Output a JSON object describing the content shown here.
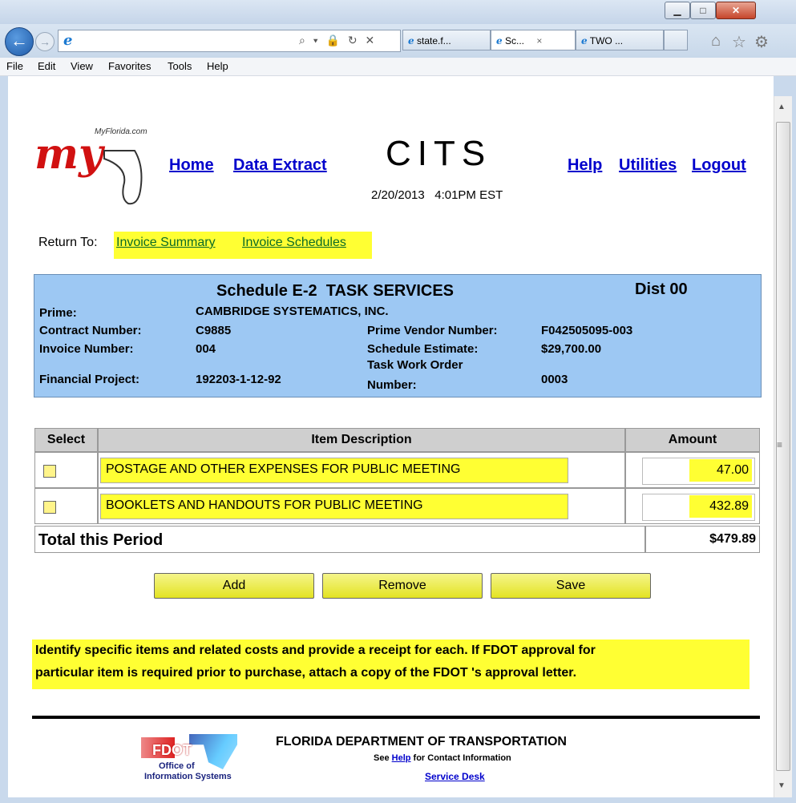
{
  "browser": {
    "tabs": [
      {
        "label": "state.f..."
      },
      {
        "label": "Sc...",
        "close": "×"
      },
      {
        "label": "TWO ..."
      }
    ],
    "address_icons": "⌕ ▾ 🔒 ↻ ✕",
    "menu": [
      "File",
      "Edit",
      "View",
      "Favorites",
      "Tools",
      "Help"
    ],
    "toolbar_icons": [
      "home-icon",
      "star-icon",
      "gear-icon"
    ]
  },
  "header": {
    "logo_caption": "MyFlorida.com",
    "logo_text": "my",
    "nav_left": [
      "Home",
      "Data Extract"
    ],
    "app_title": "CITS",
    "datetime": "2/20/2013   4:01PM EST",
    "nav_right": [
      "Help",
      "Utilities",
      "Logout"
    ]
  },
  "return_to": {
    "label": "Return To:",
    "links": [
      "Invoice Summary",
      "Invoice Schedules"
    ]
  },
  "schedule": {
    "title": "Schedule E-2  TASK SERVICES",
    "dist": "Dist 00",
    "prime_label": "Prime:",
    "prime_value": "CAMBRIDGE SYSTEMATICS, INC.",
    "contract_label": "Contract Number:",
    "contract_value": "C9885",
    "vendor_label": "Prime Vendor Number:",
    "vendor_value": "F042505095-003",
    "invoice_label": "Invoice Number:",
    "invoice_value": "004",
    "estimate_label": "Schedule Estimate:",
    "estimate_value": "$29,700.00",
    "project_label": "Financial Project:",
    "project_value": "192203-1-12-92",
    "two_label": "Task Work Order",
    "two_label2": "Number:",
    "two_value": "0003"
  },
  "table": {
    "headers": [
      "Select",
      "Item Description",
      "Amount"
    ],
    "rows": [
      {
        "description": "POSTAGE AND OTHER EXPENSES FOR PUBLIC MEETING",
        "amount": "47.00"
      },
      {
        "description": "BOOKLETS AND HANDOUTS FOR PUBLIC MEETING",
        "amount": "432.89"
      }
    ],
    "total_label": "Total this Period",
    "total_value": "$479.89"
  },
  "buttons": {
    "add": "Add",
    "remove": "Remove",
    "save": "Save"
  },
  "note": {
    "line1": "Identify specific items and related costs and provide a receipt for each. If FDOT approval for",
    "line2": "particular item is required prior to purchase, attach a copy of the FDOT 's approval letter."
  },
  "footer": {
    "logo_text": "FDOT",
    "logo_sub1": "Office of",
    "logo_sub2": "Information Systems",
    "dept": "FLORIDA DEPARTMENT OF TRANSPORTATION",
    "see": "See",
    "help_link": "Help",
    "for_contact": "for Contact Information",
    "service_desk": "Service Desk"
  },
  "colors": {
    "header_box": "#9dc8f3",
    "highlight": "#ffff33",
    "link": "#0000cc"
  }
}
